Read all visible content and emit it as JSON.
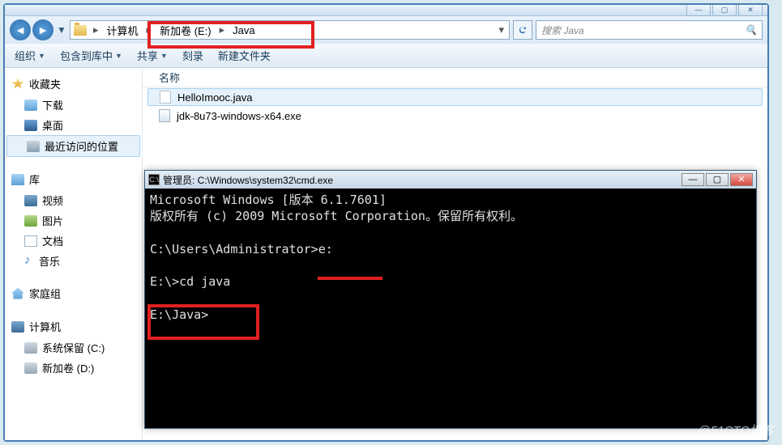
{
  "explorer": {
    "breadcrumbs": [
      "计算机",
      "新加卷 (E:)",
      "Java"
    ],
    "search_placeholder": "搜索 Java",
    "toolbar": {
      "organize": "组织",
      "include": "包含到库中",
      "share": "共享",
      "burn": "刻录",
      "new_folder": "新建文件夹"
    },
    "sidebar": {
      "favorites_title": "收藏夹",
      "favorites": [
        "下载",
        "桌面",
        "最近访问的位置"
      ],
      "libraries_title": "库",
      "libraries": [
        "视频",
        "图片",
        "文档",
        "音乐"
      ],
      "homegroup": "家庭组",
      "computer_title": "计算机",
      "drives": [
        "系统保留 (C:)",
        "新加卷 (D:)"
      ]
    },
    "column_name": "名称",
    "files": [
      "HelloImooc.java",
      "jdk-8u73-windows-x64.exe"
    ]
  },
  "cmd": {
    "title": "管理员: C:\\Windows\\system32\\cmd.exe",
    "lines": [
      "Microsoft Windows [版本 6.1.7601]",
      "版权所有 (c) 2009 Microsoft Corporation。保留所有权利。",
      "",
      "C:\\Users\\Administrator>e:",
      "",
      "E:\\>cd java",
      "",
      "E:\\Java>"
    ]
  },
  "watermark": "@51CTO博客"
}
